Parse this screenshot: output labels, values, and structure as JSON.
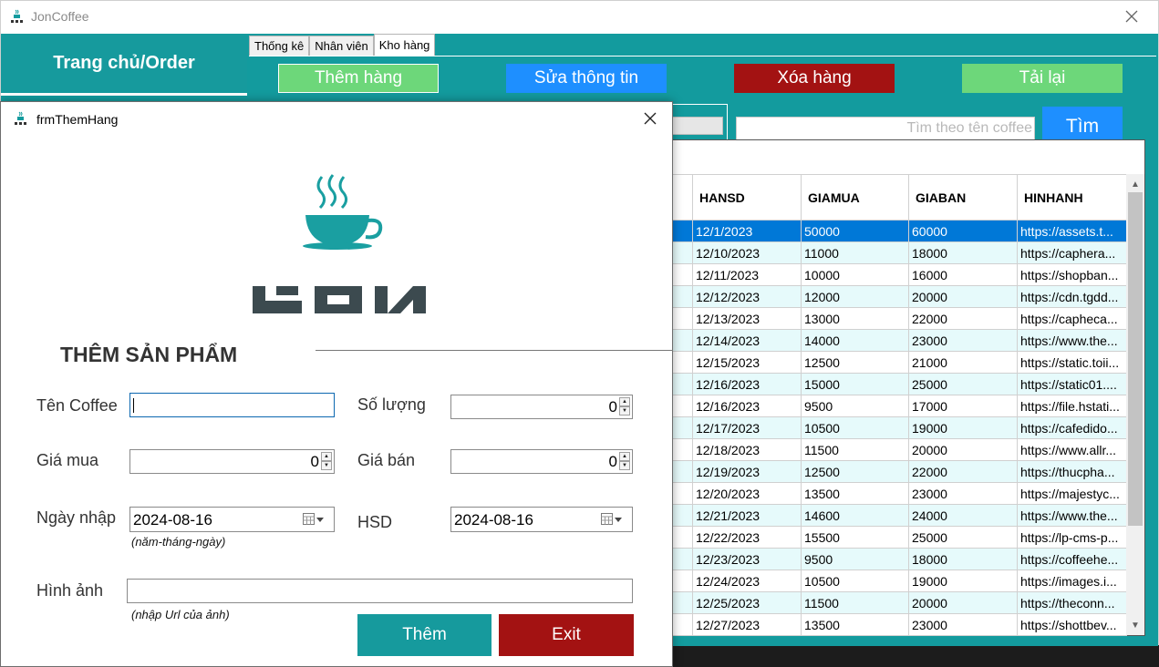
{
  "main_window": {
    "title": "JonCoffee",
    "home_button": "Trang chủ/Order",
    "tabs": [
      {
        "label": "Thống kê"
      },
      {
        "label": "Nhân viên"
      },
      {
        "label": "Kho hàng"
      }
    ],
    "toolbar": {
      "add_label": "Thêm hàng",
      "edit_label": "Sửa thông tin",
      "delete_label": "Xóa hàng",
      "reload_label": "Tải lại"
    },
    "search": {
      "placeholder": "Tìm theo tên coffee",
      "button_label": "Tìm"
    },
    "table": {
      "columns": [
        "HANSD",
        "GIAMUA",
        "GIABAN",
        "HINHANH"
      ],
      "rows": [
        [
          "12/1/2023",
          "50000",
          "60000",
          "https://assets.t..."
        ],
        [
          "12/10/2023",
          "11000",
          "18000",
          "https://caphera..."
        ],
        [
          "12/11/2023",
          "10000",
          "16000",
          "https://shopban..."
        ],
        [
          "12/12/2023",
          "12000",
          "20000",
          "https://cdn.tgdd..."
        ],
        [
          "12/13/2023",
          "13000",
          "22000",
          "https://capheca..."
        ],
        [
          "12/14/2023",
          "14000",
          "23000",
          "https://www.the..."
        ],
        [
          "12/15/2023",
          "12500",
          "21000",
          "https://static.toii..."
        ],
        [
          "12/16/2023",
          "15000",
          "25000",
          "https://static01...."
        ],
        [
          "12/16/2023",
          "9500",
          "17000",
          "https://file.hstati..."
        ],
        [
          "12/17/2023",
          "10500",
          "19000",
          "https://cafedido..."
        ],
        [
          "12/18/2023",
          "11500",
          "20000",
          "https://www.allr..."
        ],
        [
          "12/19/2023",
          "12500",
          "22000",
          "https://thucpha..."
        ],
        [
          "12/20/2023",
          "13500",
          "23000",
          "https://majestyc..."
        ],
        [
          "12/21/2023",
          "14600",
          "24000",
          "https://www.the..."
        ],
        [
          "12/22/2023",
          "15500",
          "25000",
          "https://lp-cms-p..."
        ],
        [
          "12/23/2023",
          "9500",
          "18000",
          "https://coffeehe..."
        ],
        [
          "12/24/2023",
          "10500",
          "19000",
          "https://images.i..."
        ],
        [
          "12/25/2023",
          "11500",
          "20000",
          "https://theconn..."
        ],
        [
          "12/27/2023",
          "13500",
          "23000",
          "https://shottbev..."
        ]
      ]
    }
  },
  "dialog": {
    "title": "frmThemHang",
    "heading": "THÊM SẢN PHẨM",
    "labels": {
      "name": "Tên Coffee",
      "quantity": "Số lượng",
      "buy_price": "Giá mua",
      "sell_price": "Giá bán",
      "import_date": "Ngày nhập",
      "expiry": "HSD",
      "image": "Hình ảnh"
    },
    "values": {
      "name": "",
      "quantity": "0",
      "buy_price": "0",
      "sell_price": "0",
      "import_date": "2024-08-16",
      "expiry": "2024-08-16",
      "image_url": ""
    },
    "notes": {
      "date_format": "(năm-tháng-ngày)",
      "image_hint": "(nhập Url của ảnh)"
    },
    "buttons": {
      "add": "Thêm",
      "exit": "Exit"
    }
  },
  "colors": {
    "teal": "#139b9e",
    "green": "#6dd77a",
    "blue": "#1e8fff",
    "red": "#a31212",
    "selection": "#0078d7",
    "row_alt": "#e6fafb"
  },
  "icons": [
    "app-icon",
    "close-icon",
    "coffee-cup-logo",
    "calendar-icon",
    "spin-up-icon",
    "spin-down-icon"
  ]
}
